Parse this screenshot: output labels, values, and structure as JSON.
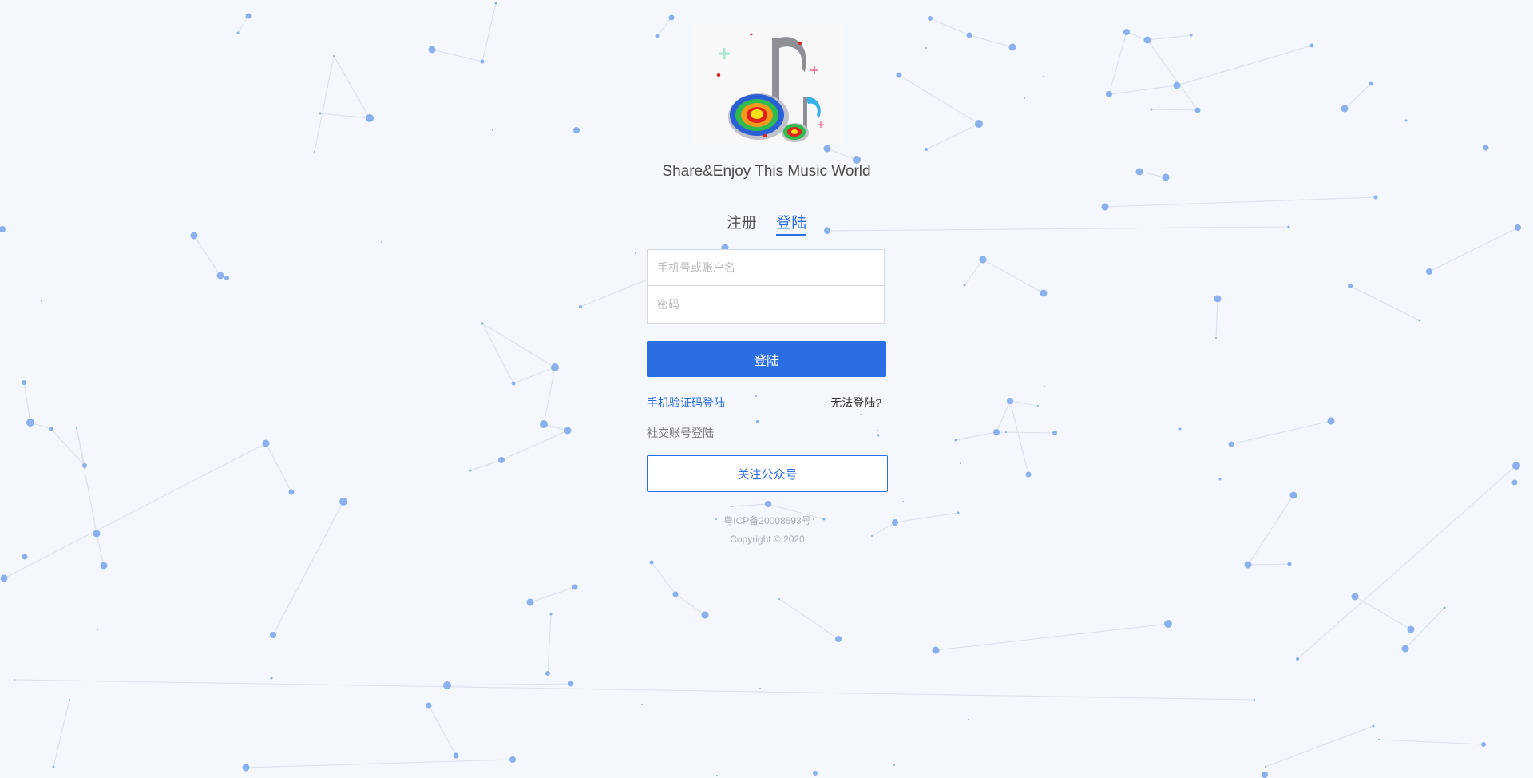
{
  "logo": {
    "icon": "music-note-icon",
    "colors": {
      "note_gray": "#8e9096",
      "note_blue": "#37b2e6",
      "ring_red": "#e32020",
      "ring_orange": "#f39a1c",
      "ring_yellow": "#f5e21a",
      "ring_green": "#2fbb4d",
      "ring_blue": "#2a5fd6",
      "sparkle_pink": "#f25b8a",
      "sparkle_mint": "#a7e8cc"
    }
  },
  "slogan": "Share&Enjoy This Music World",
  "tabs": [
    {
      "label": "注册",
      "active": false
    },
    {
      "label": "登陆",
      "active": true
    }
  ],
  "form": {
    "account_placeholder": "手机号或账户名",
    "account_value": "",
    "password_placeholder": "密码",
    "password_value": ""
  },
  "login_button": "登陆",
  "sms_login_link": "手机验证码登陆",
  "cant_login_link": "无法登陆?",
  "social_label": "社交账号登陆",
  "follow_button": "关注公众号",
  "icp": "粤ICP备20008693号",
  "copyright": "Copyright © 2020",
  "colors": {
    "accent": "#2b6de3",
    "background": "#f4f7fb",
    "particle": "#8ab0ee"
  }
}
